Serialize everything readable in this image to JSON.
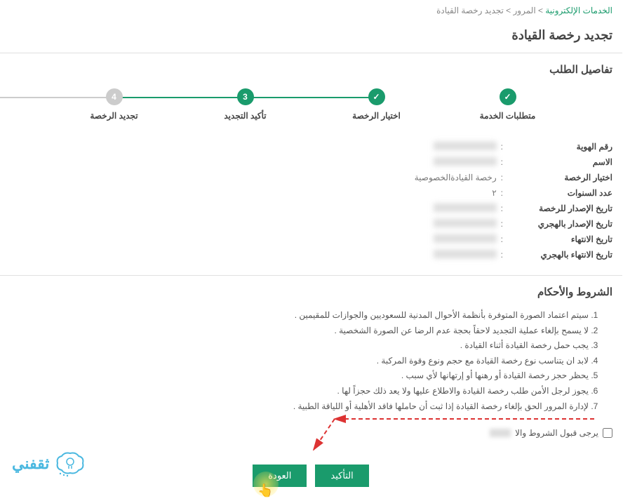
{
  "breadcrumb": {
    "link": "الخدمات الإلكترونية",
    "sep1": " > ",
    "item2": "المرور",
    "sep2": " > ",
    "item3": "تجديد رخصة القيادة"
  },
  "page_title": "تجديد رخصة القيادة",
  "section_details": "تفاصيل الطلب",
  "steps": [
    {
      "label": "متطلبات الخدمة",
      "state": "done",
      "icon": "✓"
    },
    {
      "label": "اختيار الرخصة",
      "state": "done",
      "icon": "✓"
    },
    {
      "label": "تأكيد التجديد",
      "state": "active",
      "icon": "3"
    },
    {
      "label": "تجديد الرخصة",
      "state": "pending",
      "icon": "4"
    }
  ],
  "details": [
    {
      "label": "رقم الهوية",
      "value": "",
      "blur": true
    },
    {
      "label": "الاسم",
      "value": "",
      "blur": true
    },
    {
      "label": "اختيار الرخصة",
      "value": "رخصة القيادةالخصوصية",
      "blur": false
    },
    {
      "label": "عدد السنوات",
      "value": "٢",
      "blur": false
    },
    {
      "label": "تاريخ الإصدار للرخصة",
      "value": "",
      "blur": true
    },
    {
      "label": "تاريخ الإصدار بالهجري",
      "value": "",
      "blur": true
    },
    {
      "label": "تاريخ الانتهاء",
      "value": "",
      "blur": true
    },
    {
      "label": "تاريخ الانتهاء بالهجري",
      "value": "",
      "blur": true
    }
  ],
  "section_terms": "الشروط والأحكام",
  "terms": [
    "سيتم اعتماد الصورة المتوفرة بأنظمة الأحوال المدنية للسعوديين والجوازات للمقيمين .",
    "لا يسمح بإلغاء عملية التجديد لاحقاً بحجة عدم الرضا عن الصورة الشخصية .",
    "يجب حمل رخصة القيادة أثناء القيادة .",
    "لابد ان يتناسب نوع رخصة القيادة مع حجم ونوع وقوة المركبة .",
    "يحظر حجز رخصة القيادة أو رهنها أو إرتهانها لأي سبب .",
    "يجوز لرجل الأمن طلب رخصة القيادة والاطلاع عليها ولا يعد ذلك حجزاً لها .",
    "لإدارة المرور الحق بإلغاء رخصة القيادة إذا ثبت أن حاملها فاقد الأهلية أو اللياقة الطبية ."
  ],
  "accept_label": "يرجى قبول الشروط والا",
  "buttons": {
    "confirm": "التأكيد",
    "back": "العودة"
  },
  "logo_text": "ثقفني"
}
